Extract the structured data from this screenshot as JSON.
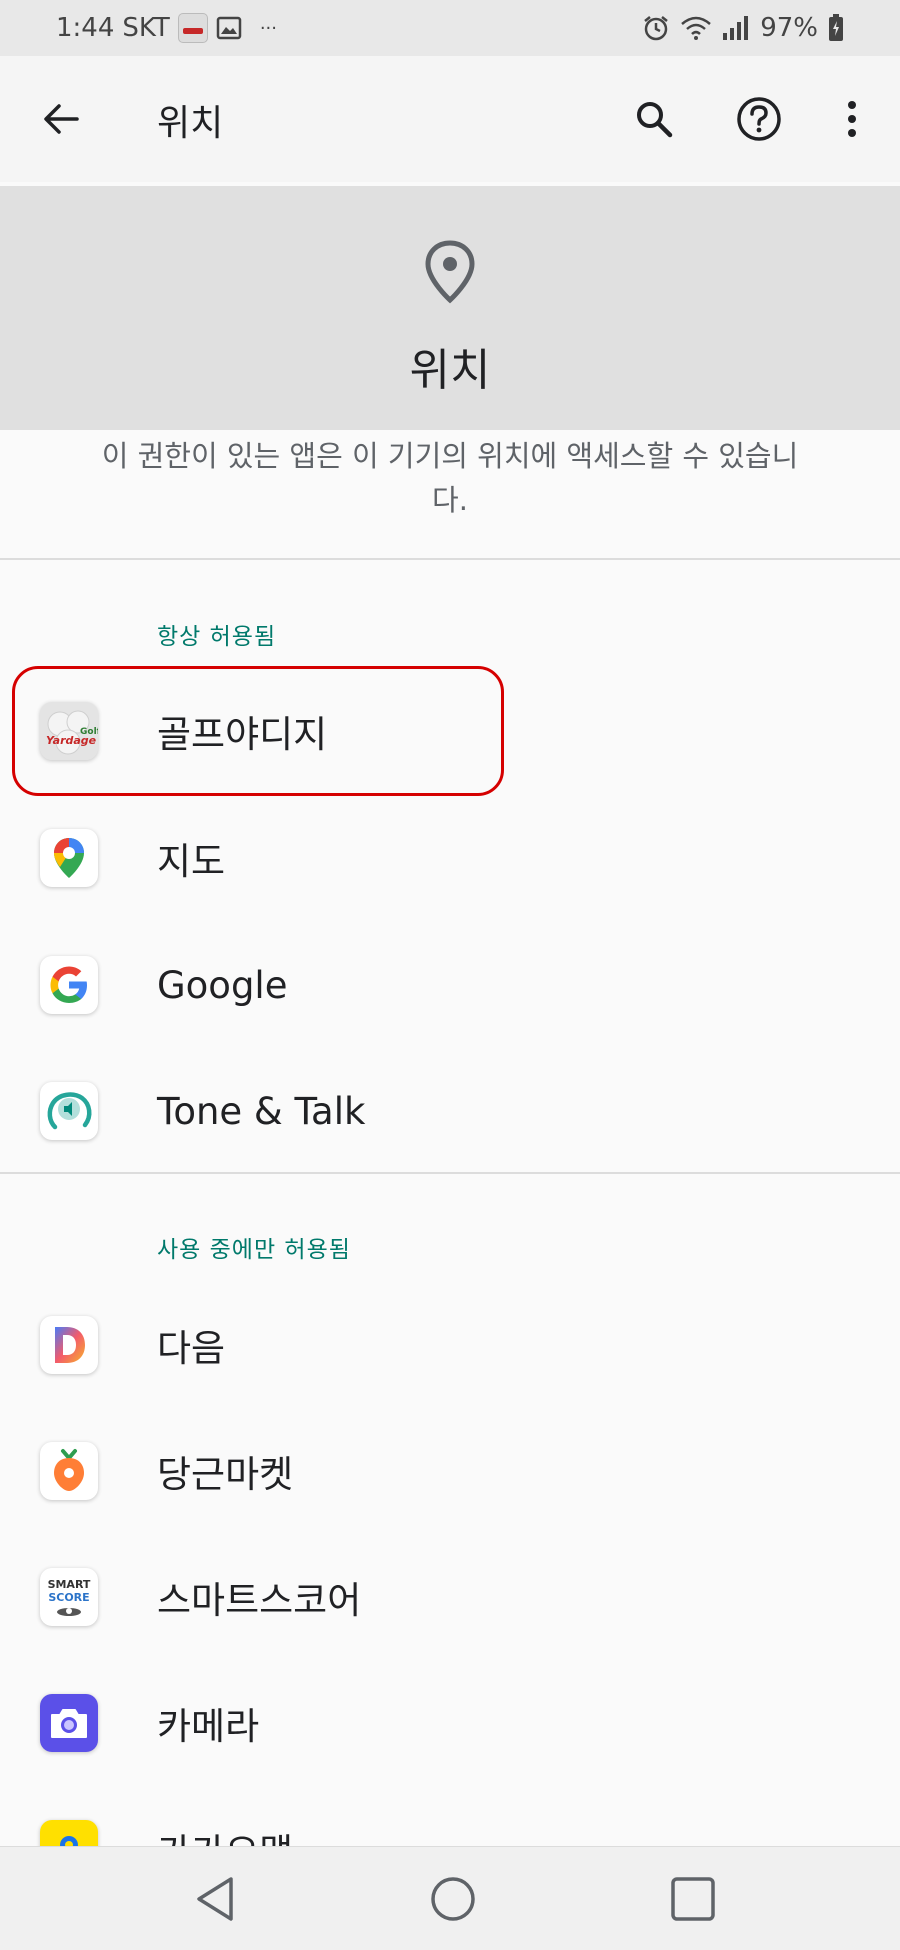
{
  "status_bar": {
    "time": "1:44",
    "carrier": "SKT",
    "extra": "···",
    "battery": "97%",
    "icons": [
      "golf-yardage-notification-icon",
      "image-icon",
      "alarm-icon",
      "wifi-icon",
      "signal-icon",
      "battery-icon"
    ]
  },
  "app_bar": {
    "title": "위치",
    "icons": [
      "back-arrow-icon",
      "search-icon",
      "help-icon",
      "more-vert-icon"
    ]
  },
  "header": {
    "title": "위치",
    "icon": "location-pin-icon"
  },
  "description": "이 권한이 있는 앱은 이 기기의 위치에 액세스할 수 있습니다.",
  "sections": {
    "always": {
      "title": "항상 허용됨",
      "items": [
        {
          "label": "골프야디지",
          "icon": "golf-yardage-app-icon"
        },
        {
          "label": "지도",
          "icon": "google-maps-app-icon"
        },
        {
          "label": "Google",
          "icon": "google-app-icon"
        },
        {
          "label": "Tone & Talk",
          "icon": "tone-talk-app-icon"
        }
      ]
    },
    "while_in_use": {
      "title": "사용 중에만 허용됨",
      "items": [
        {
          "label": "다음",
          "icon": "daum-app-icon"
        },
        {
          "label": "당근마켓",
          "icon": "daangn-app-icon"
        },
        {
          "label": "스마트스코어",
          "icon": "smartscore-app-icon"
        },
        {
          "label": "카메라",
          "icon": "camera-app-icon"
        },
        {
          "label": "카카오맵",
          "icon": "kakaomap-app-icon"
        }
      ]
    }
  },
  "smartscore_icon_text": [
    "SMART",
    "SCORE"
  ],
  "golf_icon_text": [
    "Golf",
    "Yardage"
  ],
  "colors": {
    "accent": "#00796b",
    "highlight": "#d50000"
  },
  "nav_bar": {
    "icons": [
      "back-triangle-icon",
      "home-circle-icon",
      "recents-square-icon"
    ]
  }
}
